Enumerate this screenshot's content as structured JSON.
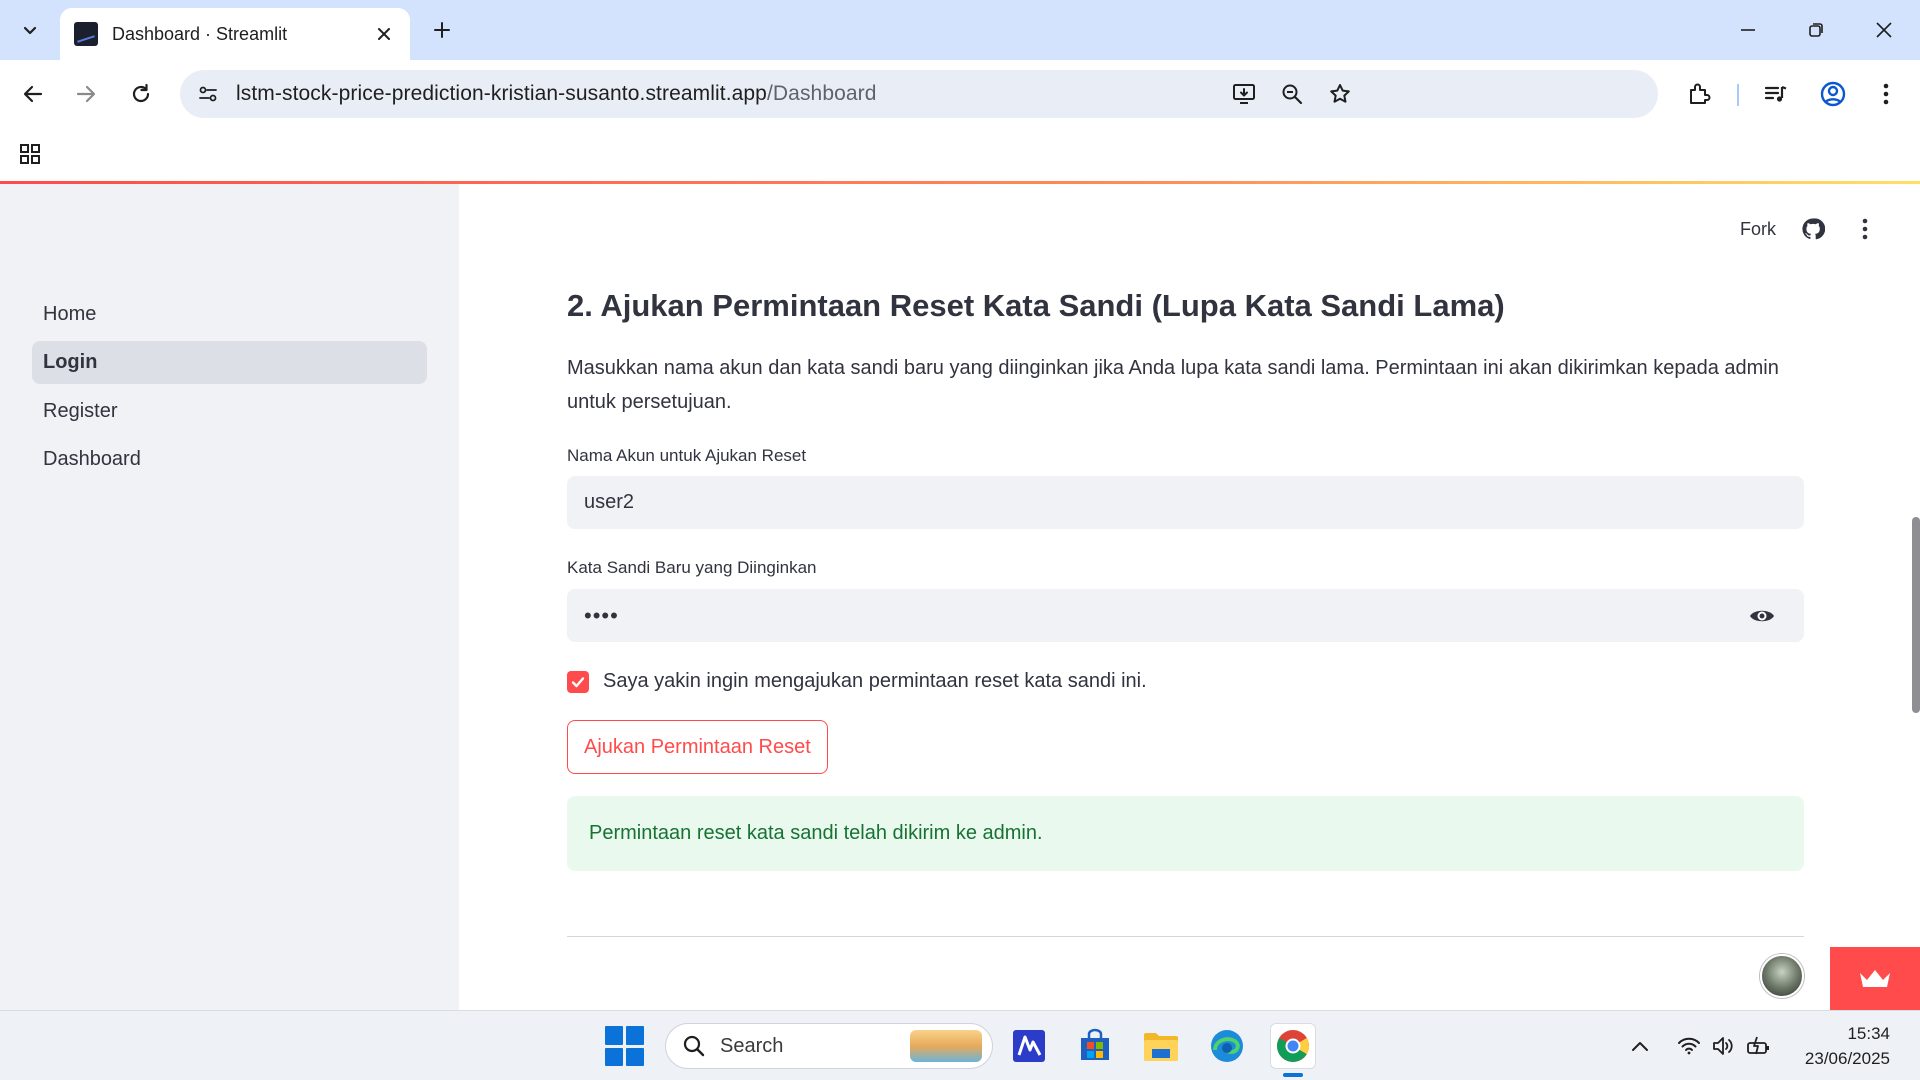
{
  "browser": {
    "tab": {
      "title": "Dashboard · Streamlit",
      "favicon": "streamlit-app-favicon"
    },
    "url": {
      "host": "lstm-stock-price-prediction-kristian-susanto.streamlit.app",
      "path": "/Dashboard"
    },
    "icons": [
      "tab-search-icon",
      "close-icon",
      "plus-icon",
      "minimize-icon",
      "restore-icon",
      "back-icon",
      "forward-icon",
      "reload-icon",
      "site-info-icon",
      "install-app-icon",
      "zoom-icon",
      "bookmark-star-icon",
      "extensions-icon",
      "media-icon",
      "profile-icon",
      "menu-icon",
      "apps-icon"
    ]
  },
  "sidebar": {
    "items": [
      {
        "label": "Home",
        "active": false
      },
      {
        "label": "Login",
        "active": true
      },
      {
        "label": "Register",
        "active": false
      },
      {
        "label": "Dashboard",
        "active": false
      }
    ]
  },
  "header": {
    "fork_label": "Fork"
  },
  "form": {
    "title": "2. Ajukan Permintaan Reset Kata Sandi (Lupa Kata Sandi Lama)",
    "description": "Masukkan nama akun dan kata sandi baru yang diinginkan jika Anda lupa kata sandi lama. Permintaan ini akan dikirimkan kepada admin untuk persetujuan.",
    "username_label": "Nama Akun untuk Ajukan Reset",
    "username_value": "user2",
    "password_label": "Kata Sandi Baru yang Diinginkan",
    "password_value": "••••",
    "confirm_label": "Saya yakin ingin mengajukan permintaan reset kata sandi ini.",
    "confirm_checked": true,
    "submit_label": "Ajukan Permintaan Reset",
    "success_message": "Permintaan reset kata sandi telah dikirim ke admin."
  },
  "taskbar": {
    "search_label": "Search",
    "time": "15:34",
    "date": "23/06/2025",
    "apps": [
      "windows-start-icon",
      "microsoft-365-icon",
      "microsoft-store-icon",
      "file-explorer-icon",
      "edge-icon",
      "chrome-icon"
    ]
  },
  "colors": {
    "accent": "#ff4b4b",
    "sidebar_bg": "#f0f2f6",
    "input_bg": "#f0f2f6",
    "success_bg": "#e9f9ee",
    "success_text": "#177233",
    "browser_tabbar": "#d3e3fd"
  }
}
